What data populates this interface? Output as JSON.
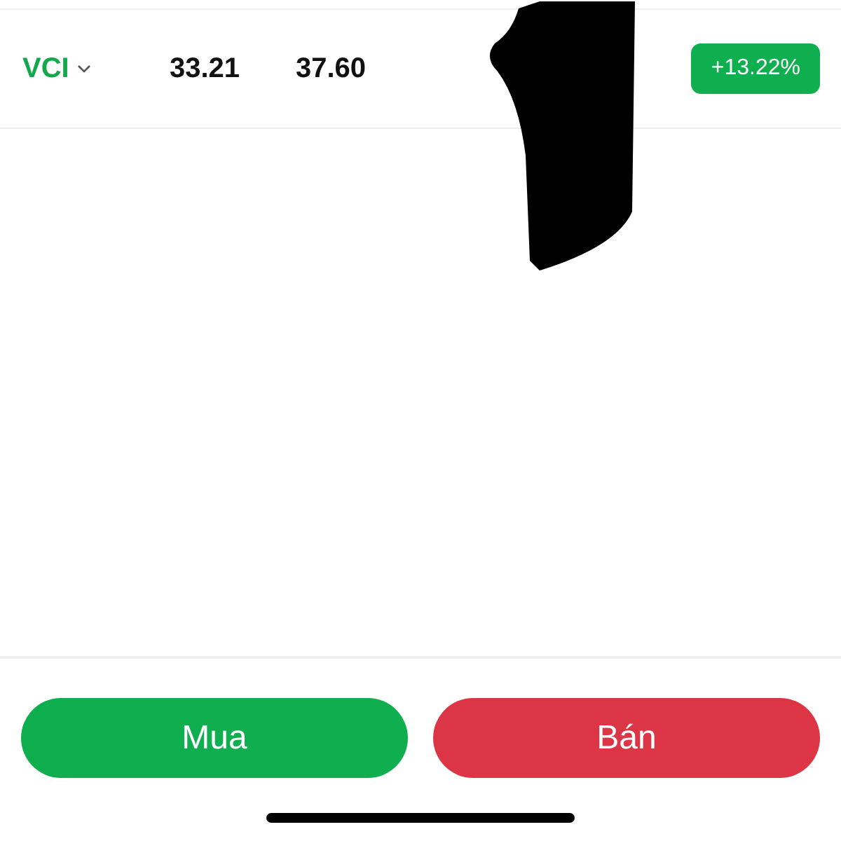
{
  "holding": {
    "symbol": "VCI",
    "column_2": "33.21",
    "column_3": "37.60",
    "change": "+13.22%"
  },
  "buttons": [
    {
      "label": "Mua",
      "kind": "buy"
    },
    {
      "label": "Bán",
      "kind": "sell"
    }
  ]
}
